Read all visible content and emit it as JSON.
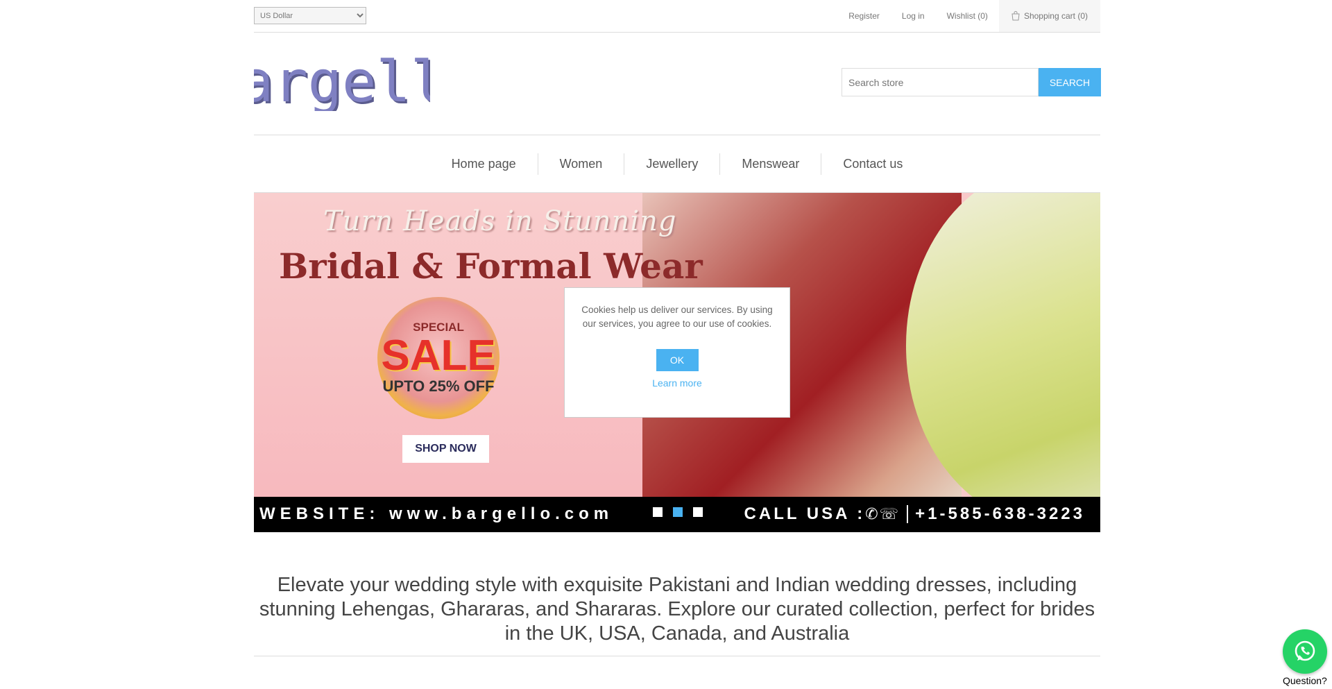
{
  "header": {
    "currency": {
      "selected": "US Dollar",
      "options": [
        "US Dollar"
      ]
    },
    "links": {
      "register": "Register",
      "login": "Log in",
      "wishlist": "Wishlist (0)",
      "cart": "Shopping cart (0)"
    }
  },
  "logo": {
    "text": "bargello",
    "color": "#7f80c2"
  },
  "search": {
    "placeholder": "Search store",
    "button_label": "Search"
  },
  "nav": {
    "items": [
      "Home page",
      "Women",
      "Jewellery",
      "Menswear",
      "Contact us"
    ]
  },
  "banner": {
    "headline1": "Turn Heads in Stunning",
    "headline2": "Bridal & Formal Wear",
    "sale_special": "SPECIAL",
    "sale_word": "SALE",
    "sale_off": "UPTO 25% OFF",
    "shop_now": "SHOP NOW",
    "website": "WEBSITE: www.bargello.com",
    "call_label": "CALL USA :",
    "phone": "+1-585-638-3223",
    "slide_count": 3,
    "active_slide": 2
  },
  "cookie": {
    "message": "Cookies help us deliver our services. By using our services, you agree to our use of cookies.",
    "ok_label": "OK",
    "learn_more": "Learn more"
  },
  "tagline": "Elevate your wedding style with exquisite Pakistani and Indian wedding dresses, including stunning Lehengas, Ghararas, and Shararas. Explore our curated collection, perfect for brides in the UK, USA, Canada, and Australia",
  "whatsapp": {
    "label": "Question?",
    "color": "#25d366"
  },
  "colors": {
    "accent": "#4ab2f1",
    "logo": "#7f80c2"
  }
}
